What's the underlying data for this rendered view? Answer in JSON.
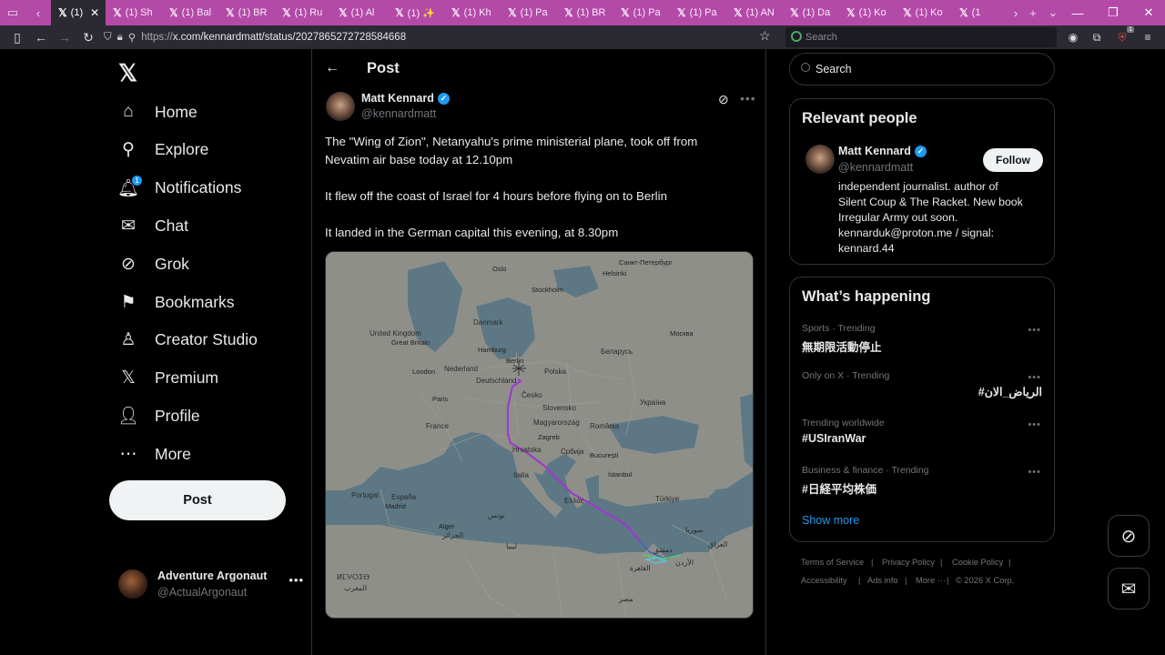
{
  "browser": {
    "tabs": [
      {
        "label": "(1)",
        "active": true
      },
      {
        "label": "(1) Sh"
      },
      {
        "label": "(1) Bal"
      },
      {
        "label": "(1) BR"
      },
      {
        "label": "(1) Ru"
      },
      {
        "label": "(1) Al"
      },
      {
        "label": "(1) ✨"
      },
      {
        "label": "(1) Kh"
      },
      {
        "label": "(1) Pa"
      },
      {
        "label": "(1) BR"
      },
      {
        "label": "(1) Pa"
      },
      {
        "label": "(1) Pa"
      },
      {
        "label": "(1) AN"
      },
      {
        "label": "(1) Da"
      },
      {
        "label": "(1) Ko"
      },
      {
        "label": "(1) Ko"
      },
      {
        "label": "(1"
      }
    ],
    "url_prefix": "https://",
    "url_rest": "x.com/kennardmatt/status/2027865272728584668",
    "search_placeholder": "Search",
    "ext_badge": "1"
  },
  "nav": {
    "items": [
      {
        "label": "Home",
        "icon": "home-icon"
      },
      {
        "label": "Explore",
        "icon": "search-icon"
      },
      {
        "label": "Notifications",
        "icon": "bell-icon",
        "badge": "1"
      },
      {
        "label": "Chat",
        "icon": "mail-icon"
      },
      {
        "label": "Grok",
        "icon": "grok-icon"
      },
      {
        "label": "Bookmarks",
        "icon": "bookmark-icon"
      },
      {
        "label": "Creator Studio",
        "icon": "creator-studio-icon"
      },
      {
        "label": "Premium",
        "icon": "x-premium-icon"
      },
      {
        "label": "Profile",
        "icon": "person-icon"
      },
      {
        "label": "More",
        "icon": "more-circle-icon"
      }
    ],
    "post_button": "Post",
    "account": {
      "name": "Adventure Argonaut",
      "handle": "@ActualArgonaut"
    }
  },
  "post": {
    "header": "Post",
    "author_name": "Matt Kennard",
    "author_handle": "@kennardmatt",
    "lines": [
      "The \"Wing of Zion\", Netanyahu's prime ministerial plane, took off from",
      "Nevatim air base today at 12.10pm",
      "It flew off the coast of Israel for 4 hours before flying on to Berlin",
      "It landed in the German capital this evening, at 8.30pm"
    ],
    "map_labels": {
      "oslo": "Oslo",
      "stockholm": "Stockholm",
      "spb": "Санкт-Петербург",
      "helsinki": "Helsinki",
      "danmark": "Danmark",
      "uk": "United Kingdom",
      "gb": "Great Britain",
      "hamburg": "Hamburg",
      "berlin": "Berlin",
      "nederland": "Nederland",
      "london": "London",
      "polska": "Polska",
      "deutschland": "Deutschland",
      "belarus": "Беларусь",
      "moskva": "Москва",
      "cesko": "Česko",
      "ukraina": "Україна",
      "paris": "Paris",
      "france": "France",
      "slovensko": "Slovensko",
      "magyarorszag": "Magyarország",
      "romania": "România",
      "zagreb": "Zagreb",
      "bucuresti": "București",
      "hrvatska": "Hrvatska",
      "italia": "Italia",
      "srbija": "Србија",
      "portugal": "Portugal",
      "espana": "España",
      "madrid": "Madrid",
      "istanbul": "İstanbul",
      "turkiye": "Türkiye",
      "ellas": "Ελλάς",
      "algeria": "Algérie",
      "alger": "Alger",
      "tunisia": "تونس",
      "libya": "ليبيا",
      "egypt": "مصر",
      "cairo": "القاهرة",
      "damascus": "دمشق",
      "iraq": "العراق",
      "syria": "سوريا",
      "morocco": "المغرب",
      "jazair": "الجزائر",
      "urdun": "الأردن",
      "tunis": "تونس",
      "maroc": "ⵍⵎⵖⵔⵉⴱ"
    }
  },
  "right": {
    "search_placeholder": "Search",
    "relevant_title": "Relevant people",
    "person": {
      "name": "Matt Kennard",
      "handle": "@kennardmatt",
      "follow": "Follow",
      "bio": [
        "independent journalist. author of",
        "Silent Coup & The Racket. New book",
        "Irregular Army out soon.",
        "kennarduk@proton.me / signal:",
        "kennard.44"
      ]
    },
    "happening_title": "What’s happening",
    "trends": [
      {
        "meta": "Sports · Trending",
        "name": "無期限活動停止"
      },
      {
        "meta": "Only on X · Trending",
        "name": "#الرياض_الان",
        "rtl": true
      },
      {
        "meta": "Trending worldwide",
        "name": "#USIranWar"
      },
      {
        "meta": "Business & finance · Trending",
        "name": "#日経平均株価"
      }
    ],
    "show_more": "Show more",
    "footer": {
      "terms": "Terms of Service",
      "privacy": "Privacy Policy",
      "cookie": "Cookie Policy",
      "accessibility": "Accessibility",
      "ads": "Ads info",
      "more": "More ···",
      "copyright": "© 2026 X Corp."
    }
  }
}
